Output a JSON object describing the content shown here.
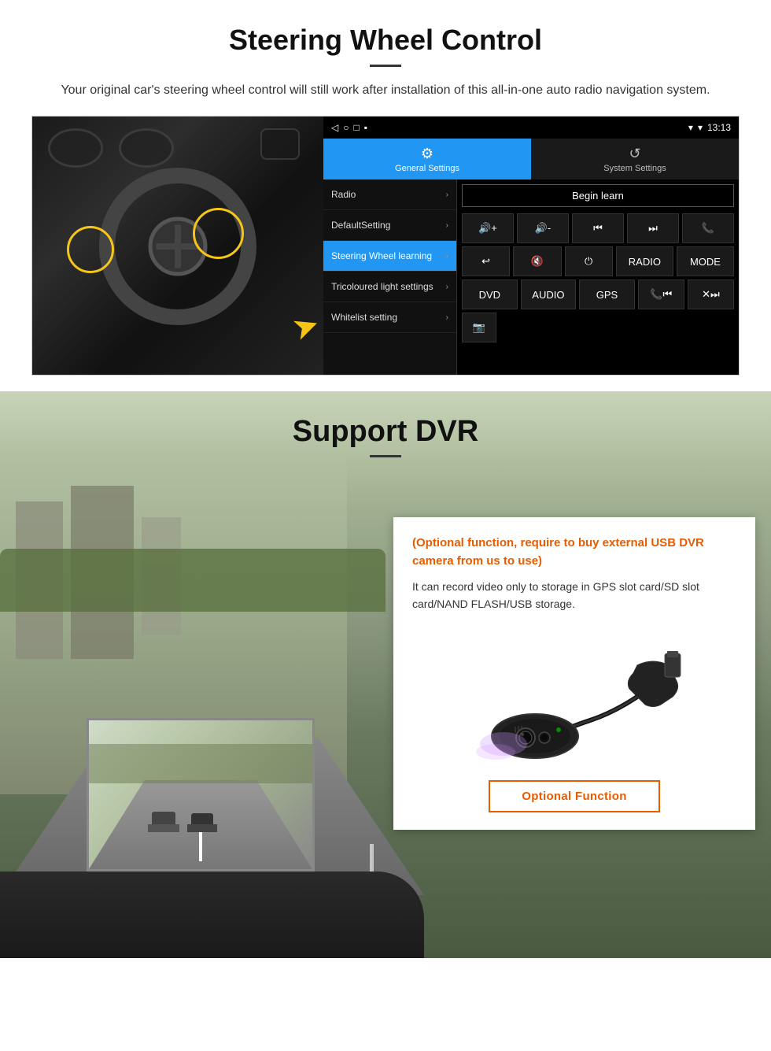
{
  "steering": {
    "title": "Steering Wheel Control",
    "description": "Your original car's steering wheel control will still work after installation of this all-in-one auto radio navigation system.",
    "android": {
      "statusbar": {
        "time": "13:13",
        "signal": "▾",
        "wifi": "▾"
      },
      "navbar": {
        "back": "◁",
        "home": "○",
        "recent": "□",
        "media": "▪"
      },
      "tabs": {
        "general_icon": "⚙",
        "general_label": "General Settings",
        "system_icon": "⟳",
        "system_label": "System Settings"
      },
      "menu_items": [
        {
          "label": "Radio",
          "active": false
        },
        {
          "label": "DefaultSetting",
          "active": false
        },
        {
          "label": "Steering Wheel learning",
          "active": true
        },
        {
          "label": "Tricoloured light settings",
          "active": false
        },
        {
          "label": "Whitelist setting",
          "active": false
        }
      ],
      "begin_learn": "Begin learn",
      "control_rows": [
        [
          "🔊+",
          "🔊-",
          "⏮",
          "⏭",
          "📞"
        ],
        [
          "↩",
          "🔇",
          "⏻",
          "RADIO",
          "MODE"
        ],
        [
          "DVD",
          "AUDIO",
          "GPS",
          "📞⏮",
          "✕⏭"
        ],
        [
          "📷"
        ]
      ]
    }
  },
  "dvr": {
    "title": "Support DVR",
    "optional_text": "(Optional function, require to buy external USB DVR camera from us to use)",
    "description": "It can record video only to storage in GPS slot card/SD slot card/NAND FLASH/USB storage.",
    "optional_btn": "Optional Function"
  }
}
